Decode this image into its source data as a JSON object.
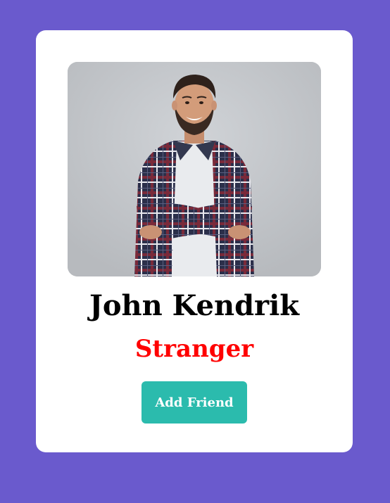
{
  "profile": {
    "name": "John Kendrik",
    "status": "Stranger",
    "add_friend_label": "Add Friend"
  },
  "colors": {
    "page_background": "#6a5acd",
    "card_background": "#ffffff",
    "status_text": "#ff0000",
    "button_background": "#2bbbad",
    "button_text": "#ffffff"
  }
}
